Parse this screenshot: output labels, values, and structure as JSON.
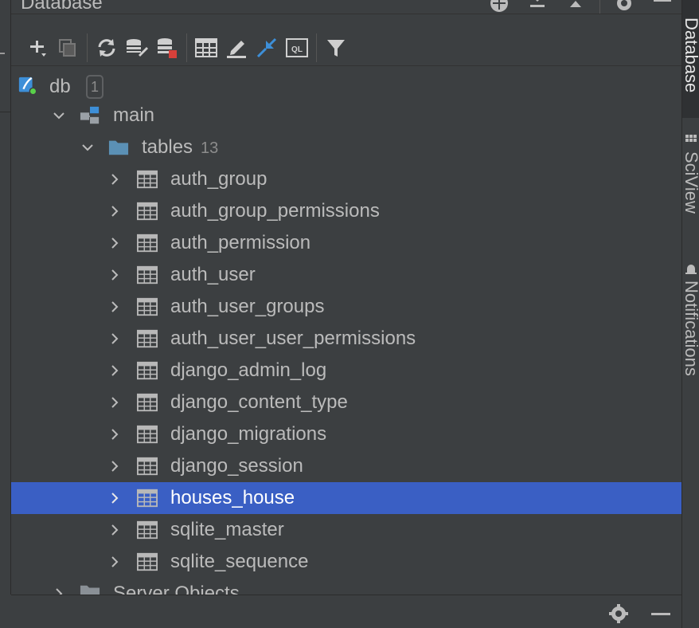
{
  "panel": {
    "title": "Database",
    "title_actions": [
      "add-circle-icon",
      "collapse-all-icon",
      "expand-all-icon",
      "gear-icon",
      "minimize-icon"
    ]
  },
  "toolbar": {
    "buttons": [
      "add-icon",
      "duplicate-icon",
      "refresh-icon",
      "properties-icon",
      "datasource-stop-icon",
      "table-view-icon",
      "edit-icon",
      "jump-to-query-icon",
      "query-console-icon",
      "filter-icon"
    ],
    "query_console_label": "QL"
  },
  "tree": {
    "root": {
      "label": "db",
      "badge": "1"
    },
    "schema": {
      "label": "main"
    },
    "folder": {
      "label": "tables",
      "count": "13"
    },
    "tables": [
      {
        "label": "auth_group",
        "selected": false
      },
      {
        "label": "auth_group_permissions",
        "selected": false
      },
      {
        "label": "auth_permission",
        "selected": false
      },
      {
        "label": "auth_user",
        "selected": false
      },
      {
        "label": "auth_user_groups",
        "selected": false
      },
      {
        "label": "auth_user_user_permissions",
        "selected": false
      },
      {
        "label": "django_admin_log",
        "selected": false
      },
      {
        "label": "django_content_type",
        "selected": false
      },
      {
        "label": "django_migrations",
        "selected": false
      },
      {
        "label": "django_session",
        "selected": false
      },
      {
        "label": "houses_house",
        "selected": true
      },
      {
        "label": "sqlite_master",
        "selected": false
      },
      {
        "label": "sqlite_sequence",
        "selected": false
      }
    ],
    "server_objects": {
      "label": "Server Objects"
    }
  },
  "side_tabs": [
    {
      "label": "Database",
      "active": true
    },
    {
      "label": "SciView",
      "active": false
    },
    {
      "label": "Notifications",
      "active": false
    }
  ],
  "bottom_bar": {
    "actions": [
      "gear-icon",
      "minimize-icon"
    ]
  },
  "colors": {
    "background": "#3c3f41",
    "selection": "#3a5fc4",
    "text": "#bbbbbb",
    "accent_blue": "#3d8fd8",
    "status_green": "#59d14a",
    "stop_red": "#d7403a"
  }
}
